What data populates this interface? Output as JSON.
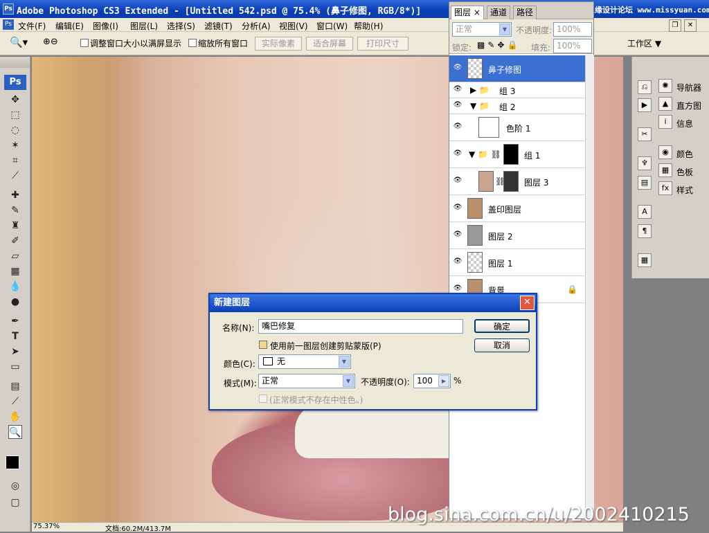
{
  "window": {
    "title": "Adobe Photoshop CS3 Extended - [Untitled 542.psd @ 75.4% (鼻子修图, RGB/8*)]",
    "app_icon": "Ps",
    "site_logo": "思缘设计论坛 www.missyuan.com"
  },
  "menu": [
    "文件(F)",
    "编辑(E)",
    "图像(I)",
    "图层(L)",
    "选择(S)",
    "滤镜(T)",
    "分析(A)",
    "视图(V)",
    "窗口(W)",
    "帮助(H)"
  ],
  "options": {
    "resize_window": "调整窗口大小以满屏显示",
    "zoom_all": "缩放所有窗口",
    "actual_pixels": "实际像素",
    "fit_screen": "适合屏幕",
    "print_size": "打印尺寸",
    "workspace": "工作区 ▼"
  },
  "toolbox": {
    "logo": "Ps"
  },
  "status": {
    "zoom": "75.37%",
    "doc": "文档:60.2M/413.7M"
  },
  "layers": {
    "tabs": [
      "图层 ×",
      "通道",
      "路径"
    ],
    "blend_mode": "正常",
    "opacity_label": "不透明度:",
    "opacity": "100%",
    "lock_label": "锁定:",
    "fill_label": "填充:",
    "fill": "100%",
    "items": [
      {
        "name": "鼻子修图"
      },
      {
        "name": "组 3"
      },
      {
        "name": "组 2"
      },
      {
        "name": "色阶 1"
      },
      {
        "name": "组 1"
      },
      {
        "name": "图层 3"
      },
      {
        "name": "盖印图层"
      },
      {
        "name": "图层 2"
      },
      {
        "name": "图层 1"
      },
      {
        "name": "背景"
      }
    ]
  },
  "dock": [
    "导航器",
    "直方图",
    "信息",
    "颜色",
    "色板",
    "样式"
  ],
  "dialog": {
    "title": "新建图层",
    "name_label": "名称(N):",
    "name_value": "嘴巴修复",
    "clip_label": "使用前一图层创建剪贴蒙版(P)",
    "color_label": "颜色(C):",
    "color_value": "无",
    "mode_label": "模式(M):",
    "mode_value": "正常",
    "opacity_label": "不透明度(O):",
    "opacity_value": "100",
    "opacity_unit": "%",
    "neutral_label": "(正常模式不存在中性色。)",
    "ok": "确定",
    "cancel": "取消"
  },
  "watermark": "blog.sina.com.cn/u/2002410215"
}
